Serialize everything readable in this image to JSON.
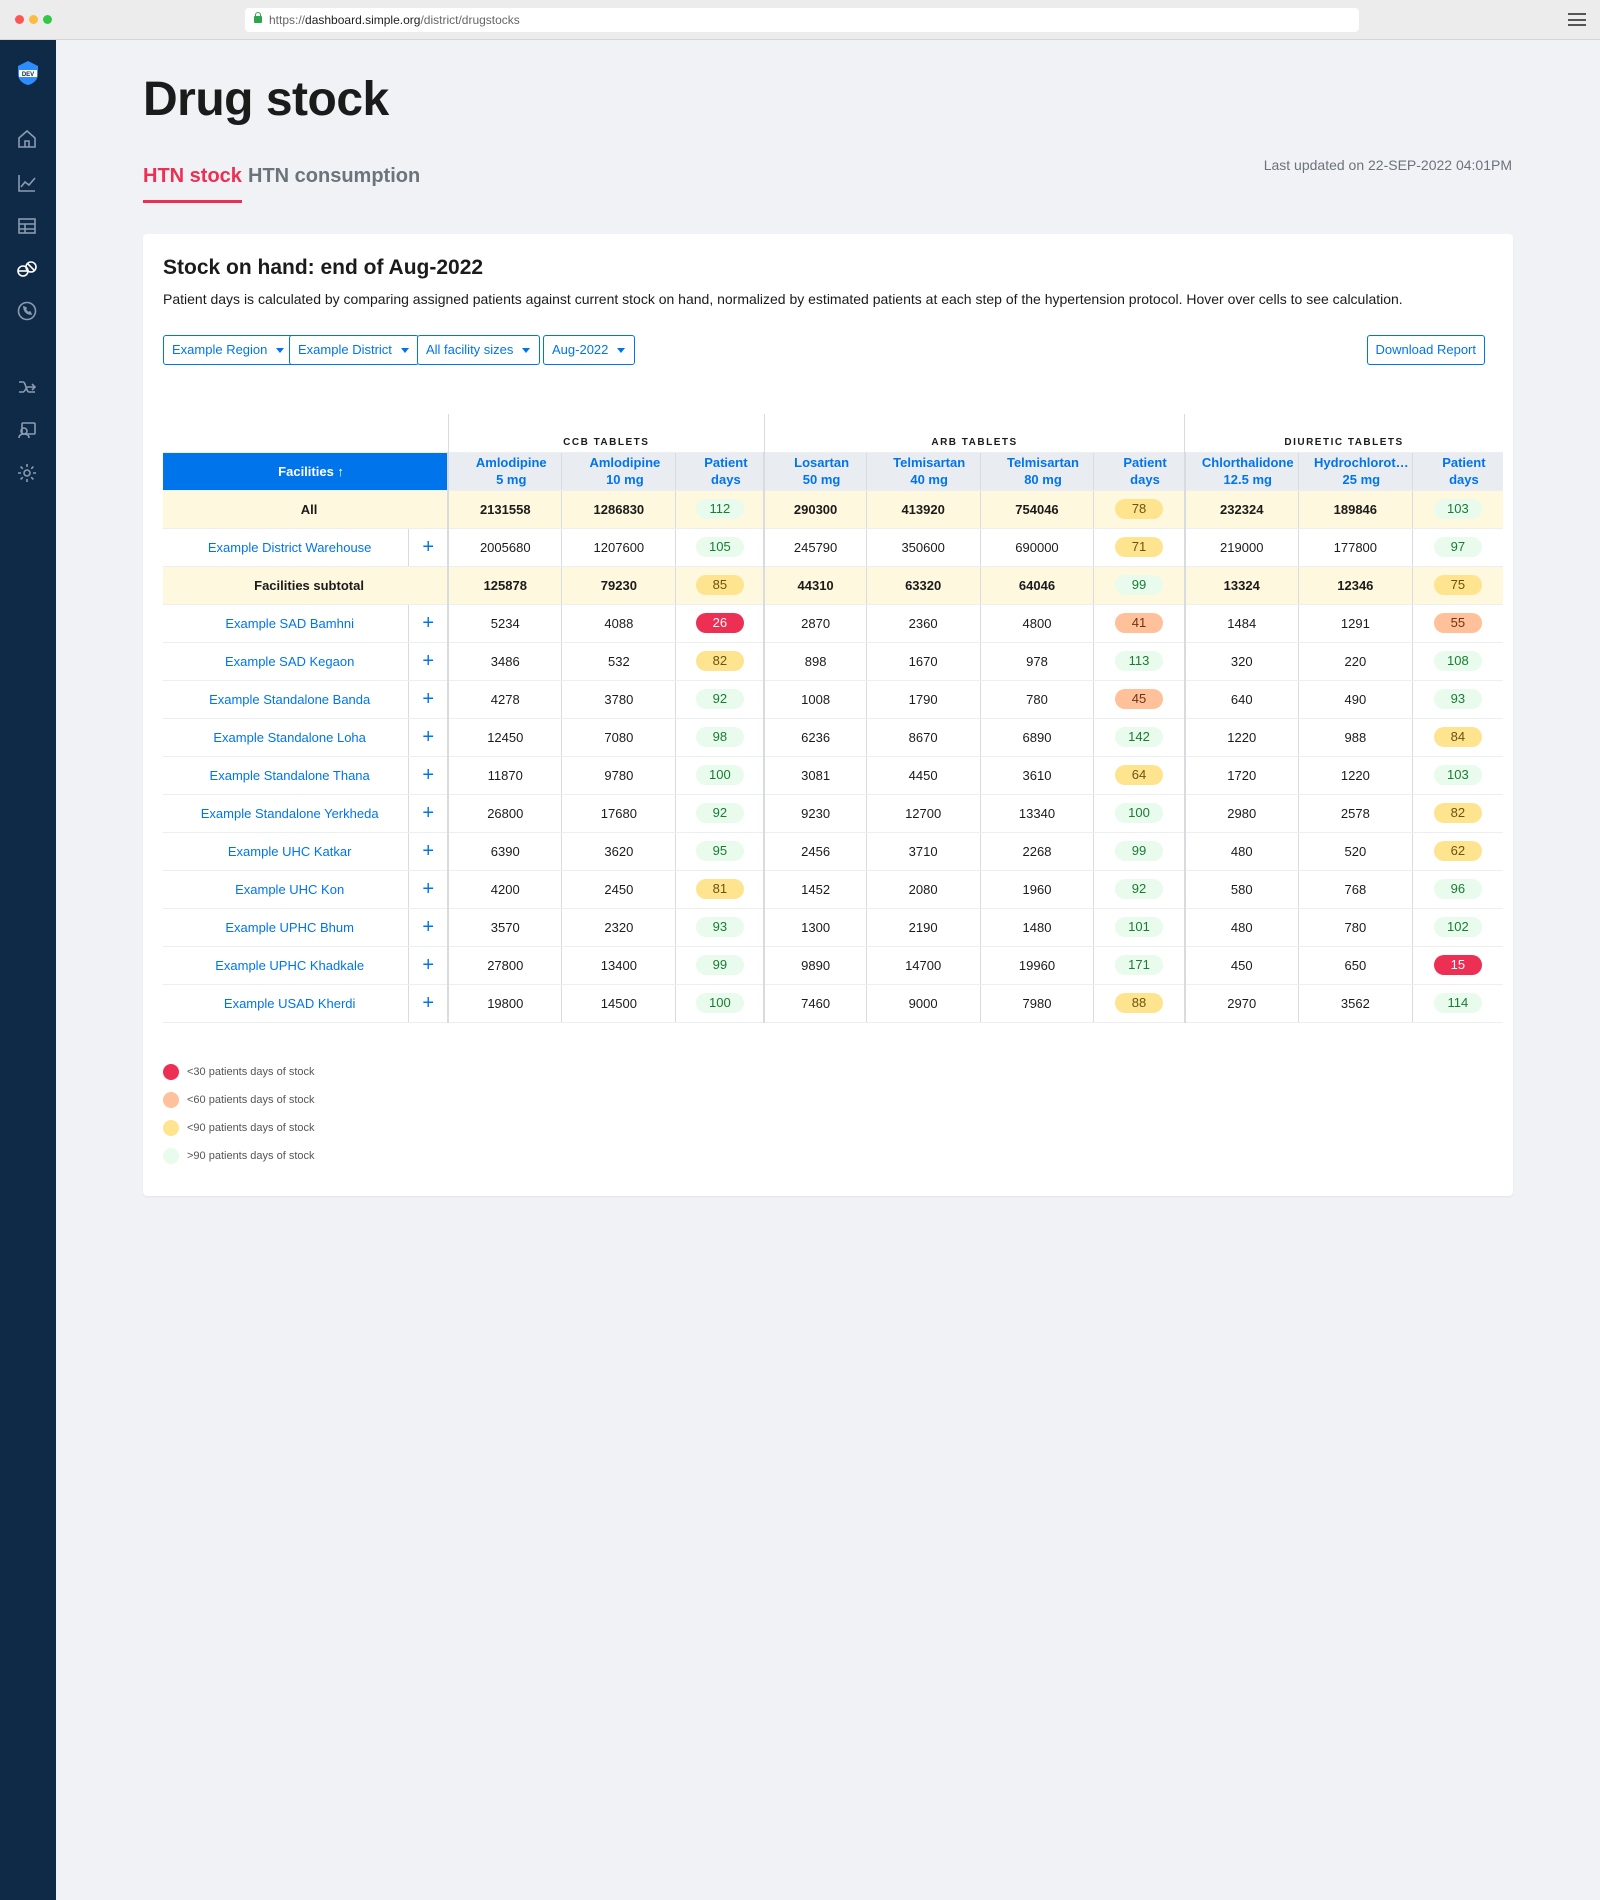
{
  "browser": {
    "url_scheme": "https://",
    "url_host": "dashboard.simple.org",
    "url_path": "/district/drugstocks"
  },
  "sidebar": {
    "logo_text": "DEV",
    "icons": [
      "home-icon",
      "chart-icon",
      "table-icon",
      "pill-icon",
      "phone-icon",
      "merge-icon",
      "user-card-icon",
      "gear-icon"
    ]
  },
  "page": {
    "title": "Drug stock",
    "tabs": [
      "HTN stock",
      "HTN consumption"
    ],
    "last_updated": "Last updated on 22-SEP-2022 04:01PM"
  },
  "card": {
    "title": "Stock on hand: end of Aug-2022",
    "description": "Patient days is calculated by comparing assigned patients against current stock on hand, normalized by estimated patients at each step of the hypertension protocol. Hover over cells to see calculation.",
    "filters": [
      "Example Region",
      "Example District",
      "All facility sizes",
      "Aug-2022"
    ],
    "download_label": "Download Report"
  },
  "table": {
    "groups": [
      "CCB TABLETS",
      "ARB TABLETS",
      "DIURETIC TABLETS"
    ],
    "facilities_header": "Facilities ↑",
    "columns": [
      [
        "Amlodipine",
        "5 mg"
      ],
      [
        "Amlodipine",
        "10 mg"
      ],
      [
        "Patient",
        "days"
      ],
      [
        "Losartan",
        "50 mg"
      ],
      [
        "Telmisartan",
        "40 mg"
      ],
      [
        "Telmisartan",
        "80 mg"
      ],
      [
        "Patient",
        "days"
      ],
      [
        "Chlorthalidone",
        "12.5 mg"
      ],
      [
        "Hydrochlorot…",
        "25 mg"
      ],
      [
        "Patient",
        "days"
      ]
    ],
    "rows": [
      {
        "name": "All",
        "highlight": true,
        "expandable": false,
        "values": [
          "2131558",
          "1286830",
          "112",
          "290300",
          "413920",
          "754046",
          "78",
          "232324",
          "189846",
          "103"
        ],
        "levels": [
          "green",
          "yellow",
          "green"
        ]
      },
      {
        "name": "Example District Warehouse",
        "highlight": false,
        "expandable": true,
        "values": [
          "2005680",
          "1207600",
          "105",
          "245790",
          "350600",
          "690000",
          "71",
          "219000",
          "177800",
          "97"
        ],
        "levels": [
          "green",
          "yellow",
          "green"
        ]
      },
      {
        "name": "Facilities subtotal",
        "highlight": true,
        "expandable": false,
        "values": [
          "125878",
          "79230",
          "85",
          "44310",
          "63320",
          "64046",
          "99",
          "13324",
          "12346",
          "75"
        ],
        "levels": [
          "yellow",
          "green",
          "yellow"
        ]
      },
      {
        "name": "Example SAD Bamhni",
        "highlight": false,
        "expandable": true,
        "values": [
          "5234",
          "4088",
          "26",
          "2870",
          "2360",
          "4800",
          "41",
          "1484",
          "1291",
          "55"
        ],
        "levels": [
          "red",
          "orange",
          "orange"
        ]
      },
      {
        "name": "Example SAD Kegaon",
        "highlight": false,
        "expandable": true,
        "values": [
          "3486",
          "532",
          "82",
          "898",
          "1670",
          "978",
          "113",
          "320",
          "220",
          "108"
        ],
        "levels": [
          "yellow",
          "green",
          "green"
        ]
      },
      {
        "name": "Example Standalone Banda",
        "highlight": false,
        "expandable": true,
        "values": [
          "4278",
          "3780",
          "92",
          "1008",
          "1790",
          "780",
          "45",
          "640",
          "490",
          "93"
        ],
        "levels": [
          "green",
          "orange",
          "green"
        ]
      },
      {
        "name": "Example Standalone Loha",
        "highlight": false,
        "expandable": true,
        "values": [
          "12450",
          "7080",
          "98",
          "6236",
          "8670",
          "6890",
          "142",
          "1220",
          "988",
          "84"
        ],
        "levels": [
          "green",
          "green",
          "yellow"
        ]
      },
      {
        "name": "Example Standalone Thana",
        "highlight": false,
        "expandable": true,
        "values": [
          "11870",
          "9780",
          "100",
          "3081",
          "4450",
          "3610",
          "64",
          "1720",
          "1220",
          "103"
        ],
        "levels": [
          "green",
          "yellow",
          "green"
        ]
      },
      {
        "name": "Example Standalone Yerkheda",
        "highlight": false,
        "expandable": true,
        "values": [
          "26800",
          "17680",
          "92",
          "9230",
          "12700",
          "13340",
          "100",
          "2980",
          "2578",
          "82"
        ],
        "levels": [
          "green",
          "green",
          "yellow"
        ]
      },
      {
        "name": "Example UHC Katkar",
        "highlight": false,
        "expandable": true,
        "values": [
          "6390",
          "3620",
          "95",
          "2456",
          "3710",
          "2268",
          "99",
          "480",
          "520",
          "62"
        ],
        "levels": [
          "green",
          "green",
          "yellow"
        ]
      },
      {
        "name": "Example UHC Kon",
        "highlight": false,
        "expandable": true,
        "values": [
          "4200",
          "2450",
          "81",
          "1452",
          "2080",
          "1960",
          "92",
          "580",
          "768",
          "96"
        ],
        "levels": [
          "yellow",
          "green",
          "green"
        ]
      },
      {
        "name": "Example UPHC Bhum",
        "highlight": false,
        "expandable": true,
        "values": [
          "3570",
          "2320",
          "93",
          "1300",
          "2190",
          "1480",
          "101",
          "480",
          "780",
          "102"
        ],
        "levels": [
          "green",
          "green",
          "green"
        ]
      },
      {
        "name": "Example UPHC Khadkale",
        "highlight": false,
        "expandable": true,
        "values": [
          "27800",
          "13400",
          "99",
          "9890",
          "14700",
          "19960",
          "171",
          "450",
          "650",
          "15"
        ],
        "levels": [
          "green",
          "green",
          "red"
        ]
      },
      {
        "name": "Example USAD Kherdi",
        "highlight": false,
        "expandable": true,
        "values": [
          "19800",
          "14500",
          "100",
          "7460",
          "9000",
          "7980",
          "88",
          "2970",
          "3562",
          "114"
        ],
        "levels": [
          "green",
          "yellow",
          "green"
        ]
      }
    ]
  },
  "legend": [
    {
      "label": "<30 patients days of stock",
      "color": "#ec2f52"
    },
    {
      "label": "<60 patients days of stock",
      "color": "#ffc09a"
    },
    {
      "label": "<90 patients days of stock",
      "color": "#ffe48f"
    },
    {
      "label": ">90 patients days of stock",
      "color": "#e8fbec"
    }
  ],
  "colors": {
    "accent": "#0075eb",
    "active_tab": "#ec2f52",
    "sidebar": "#0e2a47"
  }
}
